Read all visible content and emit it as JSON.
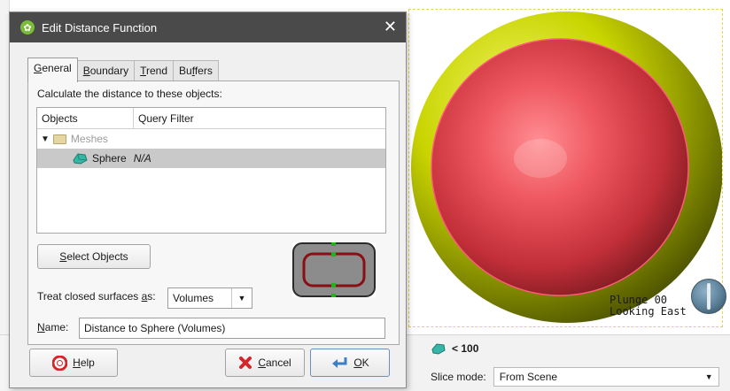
{
  "dialog": {
    "title": "Edit Distance Function",
    "close_glyph": "✕",
    "tabs": [
      {
        "pre": "",
        "mn": "G",
        "post": "eneral"
      },
      {
        "pre": "",
        "mn": "B",
        "post": "oundary"
      },
      {
        "pre": "",
        "mn": "T",
        "post": "rend"
      },
      {
        "pre": "Bu",
        "mn": "f",
        "post": "fers"
      }
    ],
    "active_tab": "General",
    "prompt": "Calculate the distance to these objects:",
    "table": {
      "columns": [
        "Objects",
        "Query Filter"
      ],
      "folder": "Meshes",
      "item_name": "Sphere",
      "item_filter": "N/A"
    },
    "select_objects": {
      "mn": "S",
      "rest": "elect Objects"
    },
    "treat": {
      "label_pre": "Treat closed surfaces ",
      "label_mn": "a",
      "label_post": "s:",
      "value": "Volumes"
    },
    "name": {
      "label_mn": "N",
      "label_post": "ame:",
      "value": "Distance to Sphere (Volumes)"
    },
    "buttons": {
      "help": {
        "mn": "H",
        "rest": "elp"
      },
      "cancel": {
        "mn": "C",
        "rest": "ancel"
      },
      "ok": {
        "mn": "O",
        "rest": "K"
      }
    }
  },
  "scene": {
    "orientation_line1": "Plunge 00",
    "orientation_line2": "Looking East"
  },
  "bottom_panel": {
    "legend_value": "< 100",
    "slice_label": "Slice mode:",
    "slice_value": "From Scene"
  },
  "colors": {
    "sphere": "#e8454f",
    "shell": "#c9d400",
    "titlebar": "#4a4a4a",
    "accent_green": "#7bbd3b"
  },
  "icons": [
    "leapfrog-app-icon",
    "close-icon",
    "folder-icon",
    "mesh-icon",
    "help-icon",
    "cancel-icon",
    "ok-icon",
    "compass-icon",
    "dropdown-arrow-icon"
  ]
}
